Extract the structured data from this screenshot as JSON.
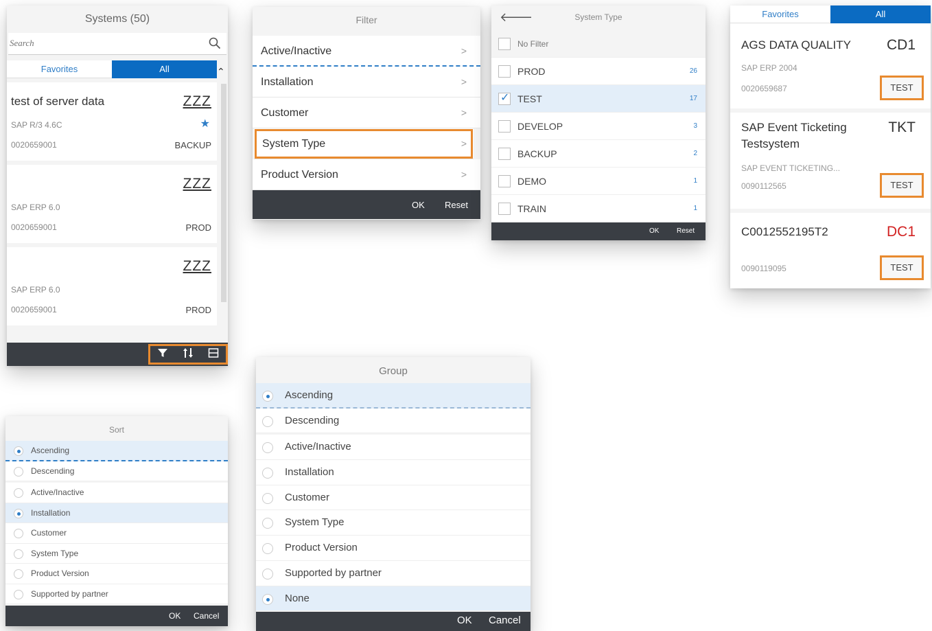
{
  "systems": {
    "title": "Systems (50)",
    "search_placeholder": "Search",
    "tabs": {
      "favorites": "Favorites",
      "all": "All"
    },
    "collapse_icon": "chevron-up-icon",
    "items": [
      {
        "name": "test of server data",
        "code": "ZZZ",
        "product": "SAP R/3 4.6C",
        "number": "0020659001",
        "type": "BACKUP",
        "favorite": true
      },
      {
        "name": "",
        "code": "ZZZ",
        "product": "SAP ERP 6.0",
        "number": "0020659001",
        "type": "PROD",
        "favorite": false
      },
      {
        "name": "",
        "code": "ZZZ",
        "product": "SAP ERP 6.0",
        "number": "0020659001",
        "type": "PROD",
        "favorite": false
      }
    ],
    "footer_icons": [
      "filter-icon",
      "sort-icon",
      "group-icon"
    ]
  },
  "filter": {
    "title": "Filter",
    "items": [
      "Active/Inactive",
      "Installation",
      "Customer",
      "System Type",
      "Product Version"
    ],
    "highlighted": "System Type",
    "ok": "OK",
    "reset": "Reset"
  },
  "system_type": {
    "title": "System Type",
    "no_filter": "No Filter",
    "items": [
      {
        "label": "PROD",
        "count": "26",
        "checked": false
      },
      {
        "label": "TEST",
        "count": "17",
        "checked": true
      },
      {
        "label": "DEVELOP",
        "count": "3",
        "checked": false
      },
      {
        "label": "BACKUP",
        "count": "2",
        "checked": false
      },
      {
        "label": "DEMO",
        "count": "1",
        "checked": false
      },
      {
        "label": "TRAIN",
        "count": "1",
        "checked": false
      }
    ],
    "ok": "OK",
    "reset": "Reset"
  },
  "favorites_panel": {
    "tabs": {
      "favorites": "Favorites",
      "all": "All"
    },
    "cards": [
      {
        "name": "AGS DATA QUALITY",
        "code": "CD1",
        "product": "SAP ERP 2004",
        "number": "0020659687",
        "type": "TEST",
        "code_color": "#333333"
      },
      {
        "name": "SAP Event Ticketing Testsystem",
        "code": "TKT",
        "product": "SAP EVENT TICKETING...",
        "number": "0090112565",
        "type": "TEST",
        "code_color": "#333333"
      },
      {
        "name": "C0012552195T2",
        "code": "DC1",
        "product": "",
        "number": "0090119095",
        "type": "TEST",
        "code_color": "#d22222"
      }
    ]
  },
  "sort": {
    "title": "Sort",
    "order": [
      {
        "label": "Ascending",
        "selected": true
      },
      {
        "label": "Descending",
        "selected": false
      }
    ],
    "fields": [
      {
        "label": "Active/Inactive",
        "selected": false
      },
      {
        "label": "Installation",
        "selected": true
      },
      {
        "label": "Customer",
        "selected": false
      },
      {
        "label": "System Type",
        "selected": false
      },
      {
        "label": "Product Version",
        "selected": false
      },
      {
        "label": "Supported by partner",
        "selected": false
      }
    ],
    "ok": "OK",
    "cancel": "Cancel"
  },
  "group": {
    "title": "Group",
    "order": [
      {
        "label": "Ascending",
        "selected": true
      },
      {
        "label": "Descending",
        "selected": false
      }
    ],
    "fields": [
      {
        "label": "Active/Inactive",
        "selected": false
      },
      {
        "label": "Installation",
        "selected": false
      },
      {
        "label": "Customer",
        "selected": false
      },
      {
        "label": "System Type",
        "selected": false
      },
      {
        "label": "Product Version",
        "selected": false
      },
      {
        "label": "Supported by partner",
        "selected": false
      },
      {
        "label": "None",
        "selected": true
      }
    ],
    "ok": "OK",
    "cancel": "Cancel"
  },
  "colors": {
    "accent": "#0b6bc2",
    "highlight_outline": "#e88a2f",
    "footer_bar": "#3a3e44",
    "selected_row": "#e3eef9"
  }
}
